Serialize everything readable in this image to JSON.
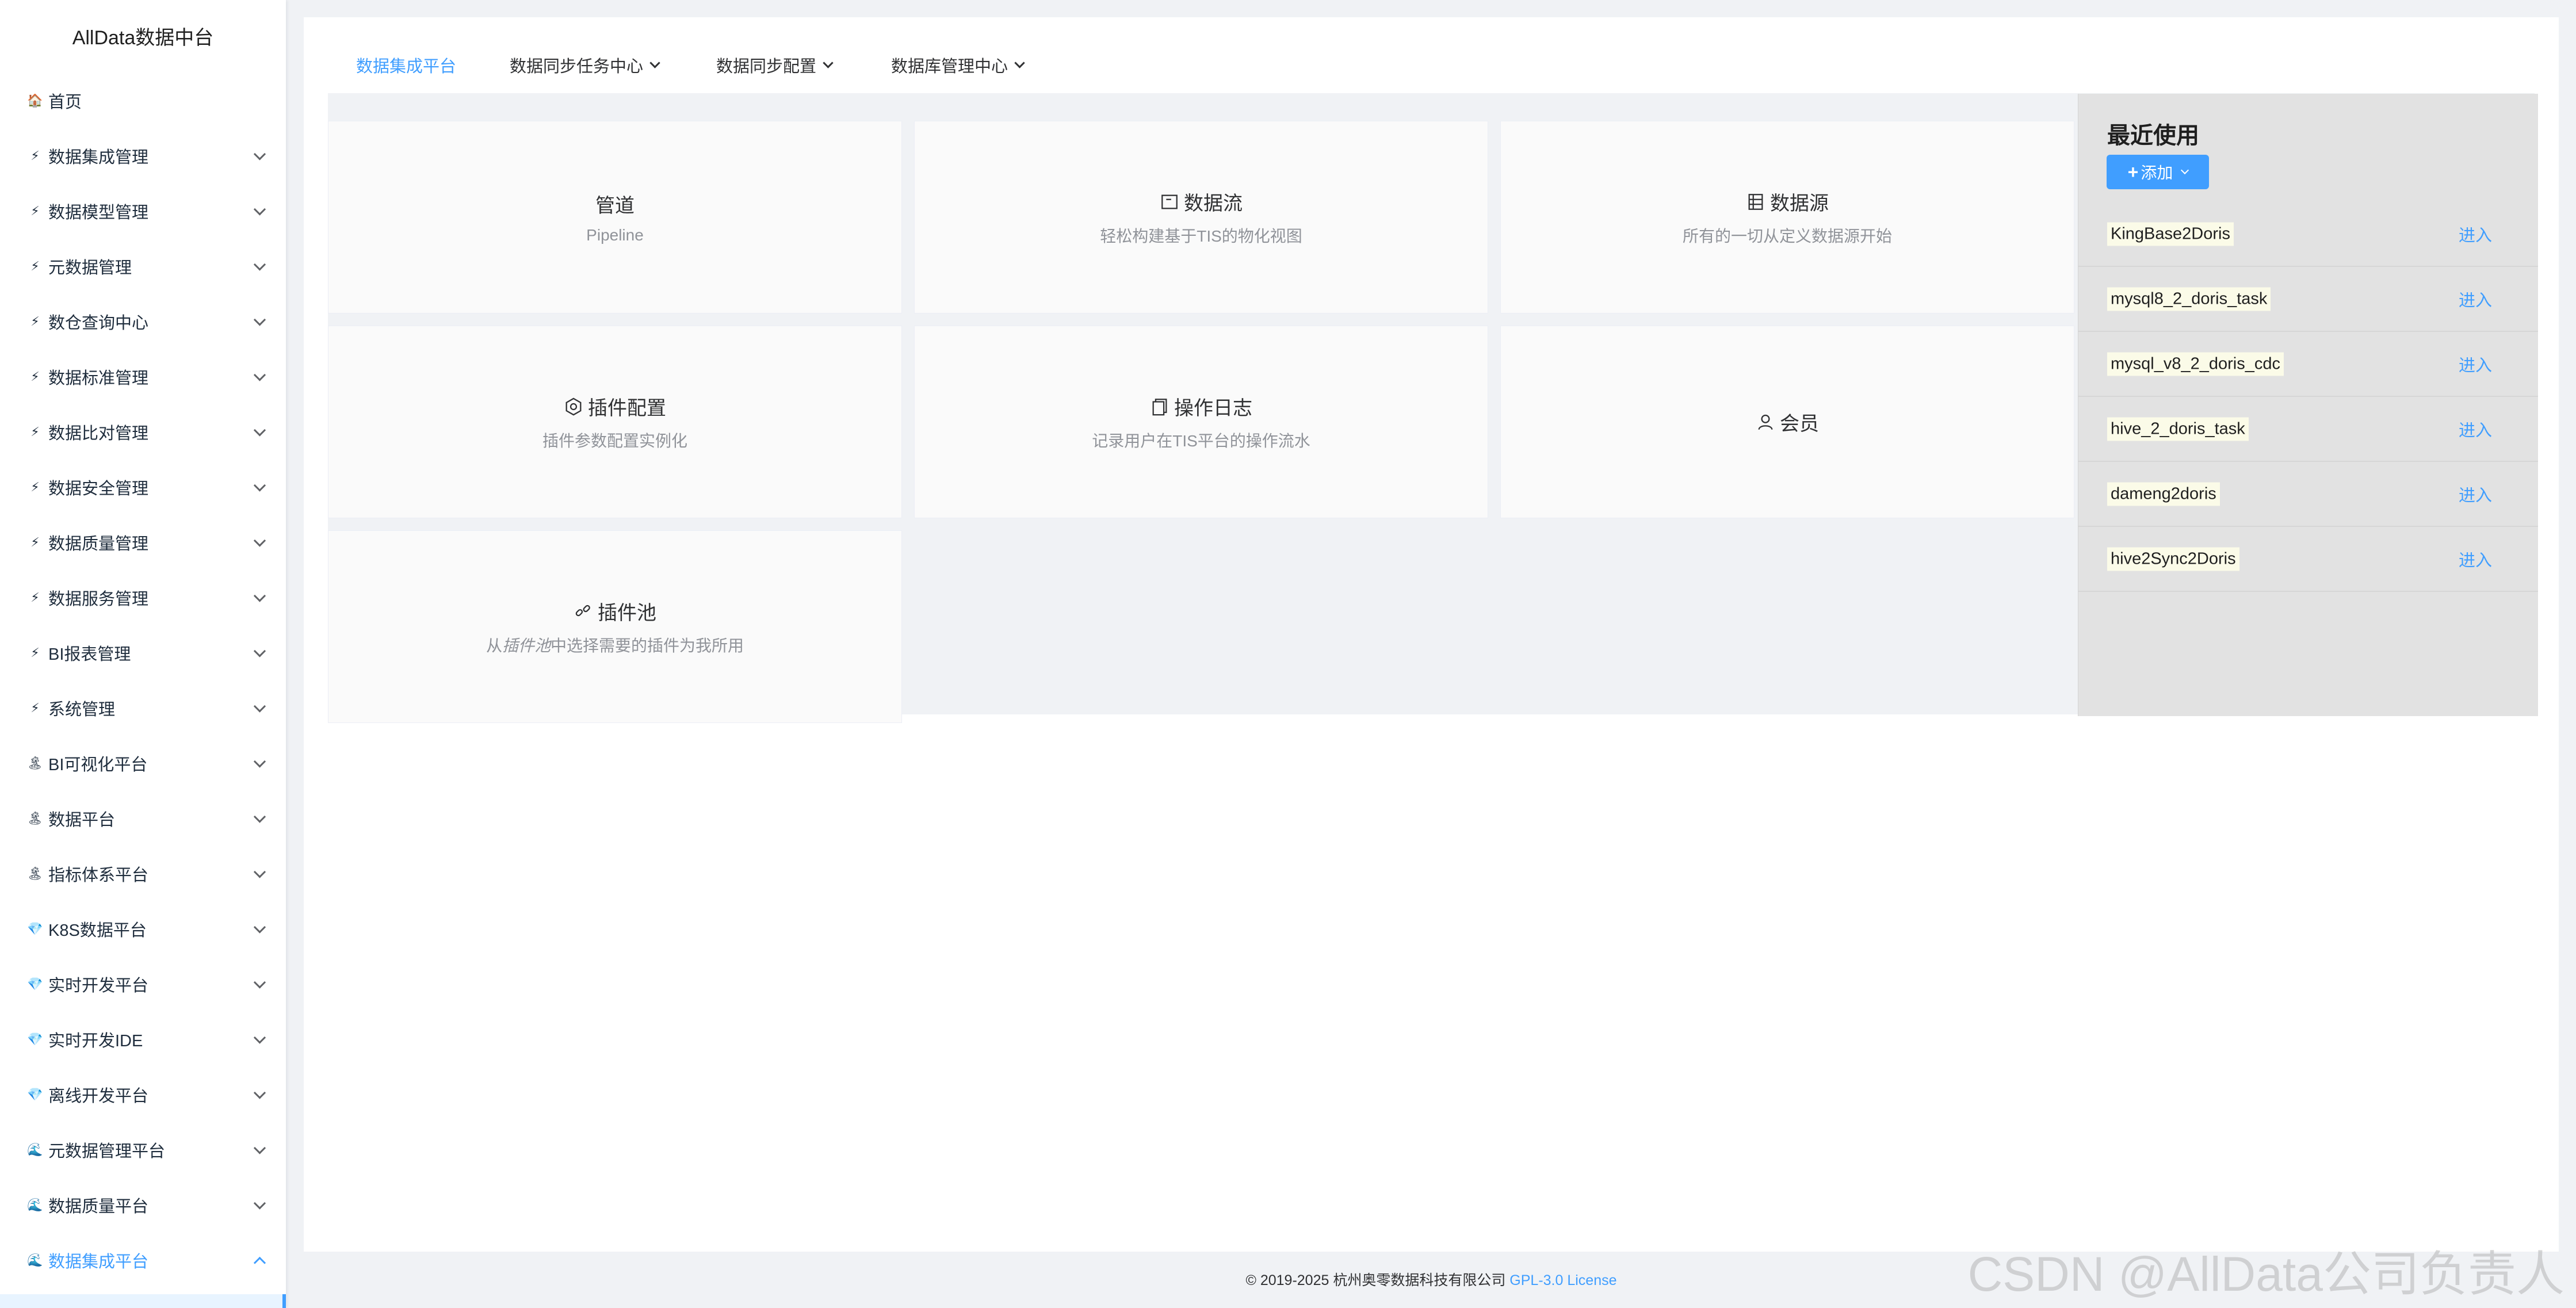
{
  "sidebar": {
    "title": "AllData数据中台",
    "items": [
      {
        "icon": "🏠",
        "label": "首页",
        "arrow": false
      },
      {
        "icon": "⚡",
        "label": "数据集成管理",
        "arrow": true
      },
      {
        "icon": "⚡",
        "label": "数据模型管理",
        "arrow": true
      },
      {
        "icon": "⚡",
        "label": "元数据管理",
        "arrow": true
      },
      {
        "icon": "⚡",
        "label": "数仓查询中心",
        "arrow": true
      },
      {
        "icon": "⚡",
        "label": "数据标准管理",
        "arrow": true
      },
      {
        "icon": "⚡",
        "label": "数据比对管理",
        "arrow": true
      },
      {
        "icon": "⚡",
        "label": "数据安全管理",
        "arrow": true
      },
      {
        "icon": "⚡",
        "label": "数据质量管理",
        "arrow": true
      },
      {
        "icon": "⚡",
        "label": "数据服务管理",
        "arrow": true
      },
      {
        "icon": "⚡",
        "label": "BI报表管理",
        "arrow": true
      },
      {
        "icon": "⚡",
        "label": "系统管理",
        "arrow": true
      },
      {
        "icon": "🏝",
        "label": "BI可视化平台",
        "arrow": true
      },
      {
        "icon": "🏝",
        "label": "数据平台",
        "arrow": true
      },
      {
        "icon": "🏝",
        "label": "指标体系平台",
        "arrow": true
      },
      {
        "icon": "💎",
        "label": "K8S数据平台",
        "arrow": true
      },
      {
        "icon": "💎",
        "label": "实时开发平台",
        "arrow": true
      },
      {
        "icon": "💎",
        "label": "实时开发IDE",
        "arrow": true
      },
      {
        "icon": "💎",
        "label": "离线开发平台",
        "arrow": true
      },
      {
        "icon": "🌊",
        "label": "元数据管理平台",
        "arrow": true
      },
      {
        "icon": "🌊",
        "label": "数据质量平台",
        "arrow": true
      },
      {
        "icon": "🌊",
        "label": "数据集成平台",
        "arrow": true,
        "open": true
      }
    ]
  },
  "topnav": {
    "items": [
      {
        "label": "数据集成平台",
        "active": true,
        "dropdown": false
      },
      {
        "label": "数据同步任务中心",
        "active": false,
        "dropdown": true
      },
      {
        "label": "数据同步配置",
        "active": false,
        "dropdown": true
      },
      {
        "label": "数据库管理中心",
        "active": false,
        "dropdown": true
      }
    ]
  },
  "cards": [
    {
      "title": "管道",
      "subtitle": "Pipeline",
      "icon": ""
    },
    {
      "title": "数据流",
      "subtitle": "轻松构建基于TIS的物化视图",
      "icon": "dataflow-icon"
    },
    {
      "title": "数据源",
      "subtitle": "所有的一切从定义数据源开始",
      "icon": "datasource-icon"
    },
    {
      "title": "插件配置",
      "subtitle": "插件参数配置实例化",
      "icon": "gear-icon"
    },
    {
      "title": "操作日志",
      "subtitle": "记录用户在TIS平台的操作流水",
      "icon": "log-icon"
    },
    {
      "title": "会员",
      "subtitle": "",
      "icon": "user-icon"
    },
    {
      "title": "插件池",
      "subtitle_pre": "从",
      "subtitle_em": "插件池",
      "subtitle_post": "中选择需要的插件为我所用",
      "icon": "link-icon"
    }
  ],
  "recent": {
    "title": "最近使用",
    "add_label": "添加",
    "enter_label": "进入",
    "items": [
      "KingBase2Doris",
      "mysql8_2_doris_task",
      "mysql_v8_2_doris_cdc",
      "hive_2_doris_task",
      "dameng2doris",
      "hive2Sync2Doris"
    ]
  },
  "footer": {
    "copyright": "© 2019-2025 杭州奥零数据科技有限公司",
    "license": "GPL-3.0 License"
  },
  "watermark": "CSDN @AllData公司负责人",
  "colors": {
    "accent": "#409eff",
    "panel": "#e2e2e2"
  }
}
